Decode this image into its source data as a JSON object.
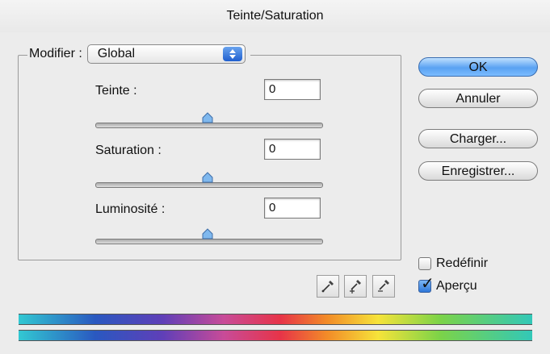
{
  "window": {
    "title": "Teinte/Saturation"
  },
  "modifier": {
    "label": "Modifier :",
    "selected": "Global"
  },
  "adjustments": {
    "hue": {
      "label": "Teinte :",
      "value": "0",
      "slider_fraction": 0.5
    },
    "saturation": {
      "label": "Saturation :",
      "value": "0",
      "slider_fraction": 0.5
    },
    "lightness": {
      "label": "Luminosité :",
      "value": "0",
      "slider_fraction": 0.5
    }
  },
  "buttons": {
    "ok": "OK",
    "cancel": "Annuler",
    "load": "Charger...",
    "save": "Enregistrer..."
  },
  "tools": [
    "eyedropper-icon",
    "eyedropper-plus-icon",
    "eyedropper-minus-icon"
  ],
  "options": {
    "colorize": {
      "label": "Redéfinir",
      "checked": false
    },
    "preview": {
      "label": "Aperçu",
      "checked": true
    }
  },
  "colors": {
    "default_button": "#5aa2f2",
    "accent": "#2e77d9"
  }
}
